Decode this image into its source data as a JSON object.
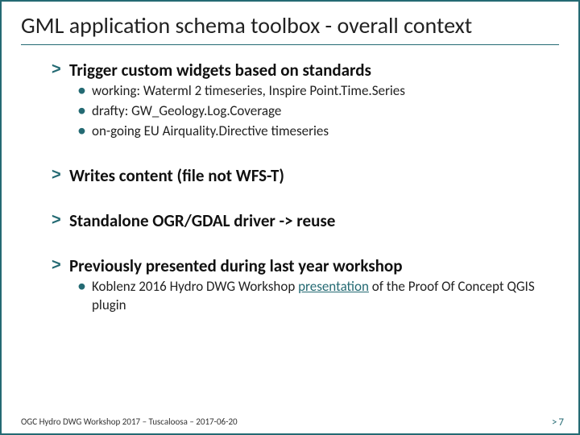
{
  "title": "GML application schema toolbox - overall context",
  "bullets": {
    "b1": {
      "heading": "Trigger custom widgets based on standards",
      "sub": {
        "s1": "working: Waterml 2 timeseries, Inspire Point.Time.Series",
        "s2": "drafty: GW_Geology.Log.Coverage",
        "s3": "on-going EU Airquality.Directive timeseries"
      }
    },
    "b2": {
      "heading": "Writes content (file not WFS-T)"
    },
    "b3": {
      "heading": "Standalone OGR/GDAL driver -> reuse"
    },
    "b4": {
      "heading": "Previously presented during last year workshop",
      "sub": {
        "s1_pre": "Koblenz 2016 Hydro DWG Workshop ",
        "s1_link": "presentation",
        "s1_post": " of the Proof Of Concept QGIS plugin"
      }
    }
  },
  "footer": "OGC Hydro DWG Workshop 2017 –  Tuscaloosa – 2017-06-20",
  "page": {
    "chevron": ">",
    "num": "7"
  },
  "glyphs": {
    "chevron": ">",
    "dot": "•"
  }
}
